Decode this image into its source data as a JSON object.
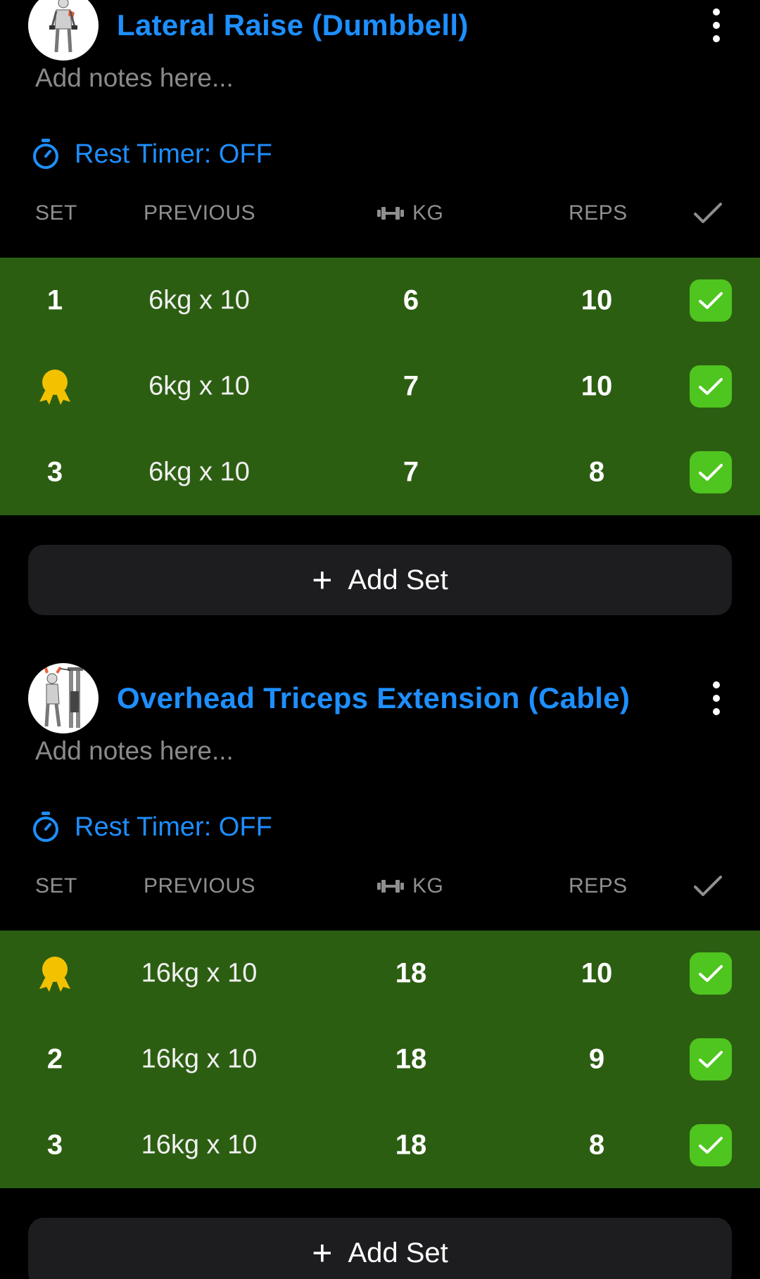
{
  "columns": {
    "set": "SET",
    "previous": "PREVIOUS",
    "kg": "KG",
    "reps": "REPS"
  },
  "exercises": [
    {
      "title": "Lateral Raise (Dumbbell)",
      "notes_placeholder": "Add notes here...",
      "rest_timer": "Rest Timer: OFF",
      "add_set_label": "Add Set",
      "sets": [
        {
          "set": "1",
          "is_record": false,
          "previous": "6kg x 10",
          "kg": "6",
          "reps": "10",
          "completed": true
        },
        {
          "set": "",
          "is_record": true,
          "previous": "6kg x 10",
          "kg": "7",
          "reps": "10",
          "completed": true
        },
        {
          "set": "3",
          "is_record": false,
          "previous": "6kg x 10",
          "kg": "7",
          "reps": "8",
          "completed": true
        }
      ]
    },
    {
      "title": "Overhead Triceps Extension (Cable)",
      "notes_placeholder": "Add notes here...",
      "rest_timer": "Rest Timer: OFF",
      "add_set_label": "Add Set",
      "sets": [
        {
          "set": "",
          "is_record": true,
          "previous": "16kg x 10",
          "kg": "18",
          "reps": "10",
          "completed": true
        },
        {
          "set": "2",
          "is_record": false,
          "previous": "16kg x 10",
          "kg": "18",
          "reps": "9",
          "completed": true
        },
        {
          "set": "3",
          "is_record": false,
          "previous": "16kg x 10",
          "kg": "18",
          "reps": "8",
          "completed": true
        }
      ]
    }
  ],
  "colors": {
    "accent": "#1e8fff",
    "completed_row": "#2c5e12",
    "check_button": "#4fc51f",
    "medal": "#f2c200",
    "add_set_bg": "#1d1d1f"
  },
  "icons": {
    "thumbnail_1": "lateral-raise-illustration",
    "thumbnail_2": "cable-triceps-illustration",
    "more": "kebab-menu-icon",
    "timer": "stopwatch-icon",
    "kg": "dumbbell-icon",
    "done": "checkmark-icon",
    "record": "medal-icon",
    "add": "plus-icon"
  }
}
